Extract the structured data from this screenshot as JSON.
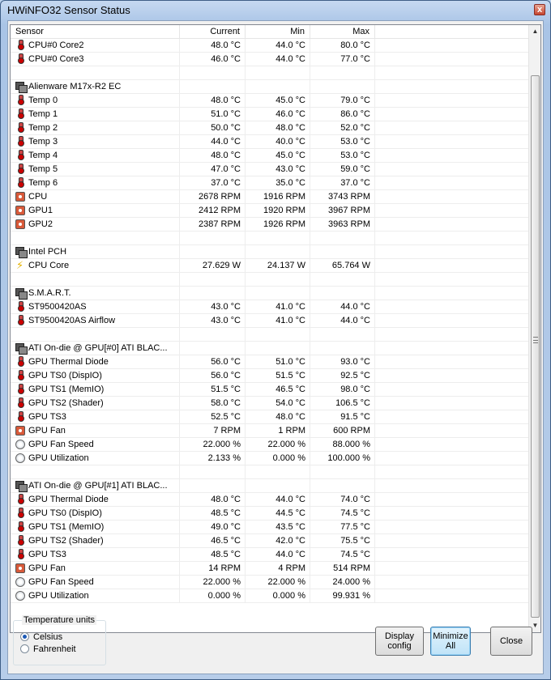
{
  "window": {
    "title": "HWiNFO32 Sensor Status",
    "close_glyph": "x"
  },
  "columns": [
    "Sensor",
    "Current",
    "Min",
    "Max"
  ],
  "rows": [
    {
      "type": "sensor",
      "icon": "thermometer-icon",
      "name": "CPU#0 Core2",
      "current": "48.0 °C",
      "min": "44.0 °C",
      "max": "80.0 °C"
    },
    {
      "type": "sensor",
      "icon": "thermometer-icon",
      "name": "CPU#0 Core3",
      "current": "46.0 °C",
      "min": "44.0 °C",
      "max": "77.0 °C"
    },
    {
      "type": "blank"
    },
    {
      "type": "group",
      "icon": "device-group-icon",
      "name": "Alienware M17x-R2 EC"
    },
    {
      "type": "sensor",
      "icon": "thermometer-icon",
      "name": "Temp 0",
      "current": "48.0 °C",
      "min": "45.0 °C",
      "max": "79.0 °C"
    },
    {
      "type": "sensor",
      "icon": "thermometer-icon",
      "name": "Temp 1",
      "current": "51.0 °C",
      "min": "46.0 °C",
      "max": "86.0 °C"
    },
    {
      "type": "sensor",
      "icon": "thermometer-icon",
      "name": "Temp 2",
      "current": "50.0 °C",
      "min": "48.0 °C",
      "max": "52.0 °C"
    },
    {
      "type": "sensor",
      "icon": "thermometer-icon",
      "name": "Temp 3",
      "current": "44.0 °C",
      "min": "40.0 °C",
      "max": "53.0 °C"
    },
    {
      "type": "sensor",
      "icon": "thermometer-icon",
      "name": "Temp 4",
      "current": "48.0 °C",
      "min": "45.0 °C",
      "max": "53.0 °C"
    },
    {
      "type": "sensor",
      "icon": "thermometer-icon",
      "name": "Temp 5",
      "current": "47.0 °C",
      "min": "43.0 °C",
      "max": "59.0 °C"
    },
    {
      "type": "sensor",
      "icon": "thermometer-icon",
      "name": "Temp 6",
      "current": "37.0 °C",
      "min": "35.0 °C",
      "max": "37.0 °C"
    },
    {
      "type": "sensor",
      "icon": "fan-icon",
      "name": "CPU",
      "current": "2678 RPM",
      "min": "1916 RPM",
      "max": "3743 RPM"
    },
    {
      "type": "sensor",
      "icon": "fan-icon",
      "name": "GPU1",
      "current": "2412 RPM",
      "min": "1920 RPM",
      "max": "3967 RPM"
    },
    {
      "type": "sensor",
      "icon": "fan-icon",
      "name": "GPU2",
      "current": "2387 RPM",
      "min": "1926 RPM",
      "max": "3963 RPM"
    },
    {
      "type": "blank"
    },
    {
      "type": "group",
      "icon": "device-group-icon",
      "name": "Intel PCH"
    },
    {
      "type": "sensor",
      "icon": "lightning-icon",
      "name": "CPU Core",
      "current": "27.629 W",
      "min": "24.137 W",
      "max": "65.764 W"
    },
    {
      "type": "blank"
    },
    {
      "type": "group",
      "icon": "device-group-icon",
      "name": "S.M.A.R.T."
    },
    {
      "type": "sensor",
      "icon": "thermometer-icon",
      "name": "ST9500420AS",
      "current": "43.0 °C",
      "min": "41.0 °C",
      "max": "44.0 °C"
    },
    {
      "type": "sensor",
      "icon": "thermometer-icon",
      "name": "ST9500420AS Airflow",
      "current": "43.0 °C",
      "min": "41.0 °C",
      "max": "44.0 °C"
    },
    {
      "type": "blank"
    },
    {
      "type": "group",
      "icon": "device-group-icon",
      "name": "ATI On-die @ GPU[#0] ATI BLAC..."
    },
    {
      "type": "sensor",
      "icon": "thermometer-icon",
      "name": "GPU Thermal Diode",
      "current": "56.0 °C",
      "min": "51.0 °C",
      "max": "93.0 °C"
    },
    {
      "type": "sensor",
      "icon": "thermometer-icon",
      "name": "GPU TS0 (DispIO)",
      "current": "56.0 °C",
      "min": "51.5 °C",
      "max": "92.5 °C"
    },
    {
      "type": "sensor",
      "icon": "thermometer-icon",
      "name": "GPU TS1 (MemIO)",
      "current": "51.5 °C",
      "min": "46.5 °C",
      "max": "98.0 °C"
    },
    {
      "type": "sensor",
      "icon": "thermometer-icon",
      "name": "GPU TS2 (Shader)",
      "current": "58.0 °C",
      "min": "54.0 °C",
      "max": "106.5 °C"
    },
    {
      "type": "sensor",
      "icon": "thermometer-icon",
      "name": "GPU TS3",
      "current": "52.5 °C",
      "min": "48.0 °C",
      "max": "91.5 °C"
    },
    {
      "type": "sensor",
      "icon": "fan-icon",
      "name": "GPU Fan",
      "current": "7 RPM",
      "min": "1 RPM",
      "max": "600 RPM"
    },
    {
      "type": "sensor",
      "icon": "gauge-icon",
      "name": "GPU Fan Speed",
      "current": "22.000 %",
      "min": "22.000 %",
      "max": "88.000 %"
    },
    {
      "type": "sensor",
      "icon": "gauge-icon",
      "name": "GPU Utilization",
      "current": "2.133 %",
      "min": "0.000 %",
      "max": "100.000 %"
    },
    {
      "type": "blank"
    },
    {
      "type": "group",
      "icon": "device-group-icon",
      "name": "ATI On-die @ GPU[#1] ATI BLAC..."
    },
    {
      "type": "sensor",
      "icon": "thermometer-icon",
      "name": "GPU Thermal Diode",
      "current": "48.0 °C",
      "min": "44.0 °C",
      "max": "74.0 °C"
    },
    {
      "type": "sensor",
      "icon": "thermometer-icon",
      "name": "GPU TS0 (DispIO)",
      "current": "48.5 °C",
      "min": "44.5 °C",
      "max": "74.5 °C"
    },
    {
      "type": "sensor",
      "icon": "thermometer-icon",
      "name": "GPU TS1 (MemIO)",
      "current": "49.0 °C",
      "min": "43.5 °C",
      "max": "77.5 °C"
    },
    {
      "type": "sensor",
      "icon": "thermometer-icon",
      "name": "GPU TS2 (Shader)",
      "current": "46.5 °C",
      "min": "42.0 °C",
      "max": "75.5 °C"
    },
    {
      "type": "sensor",
      "icon": "thermometer-icon",
      "name": "GPU TS3",
      "current": "48.5 °C",
      "min": "44.0 °C",
      "max": "74.5 °C"
    },
    {
      "type": "sensor",
      "icon": "fan-icon",
      "name": "GPU Fan",
      "current": "14 RPM",
      "min": "4 RPM",
      "max": "514 RPM"
    },
    {
      "type": "sensor",
      "icon": "gauge-icon",
      "name": "GPU Fan Speed",
      "current": "22.000 %",
      "min": "22.000 %",
      "max": "24.000 %"
    },
    {
      "type": "sensor",
      "icon": "gauge-icon",
      "name": "GPU Utilization",
      "current": "0.000 %",
      "min": "0.000 %",
      "max": "99.931 %"
    }
  ],
  "temperature_units": {
    "title": "Temperature units",
    "options": [
      "Celsius",
      "Fahrenheit"
    ],
    "selected": "Celsius"
  },
  "buttons": {
    "display_config": "Display\nconfig",
    "minimize_all": "Minimize\nAll",
    "close": "Close"
  },
  "scrollbar": {
    "up_glyph": "▲",
    "down_glyph": "▼"
  }
}
